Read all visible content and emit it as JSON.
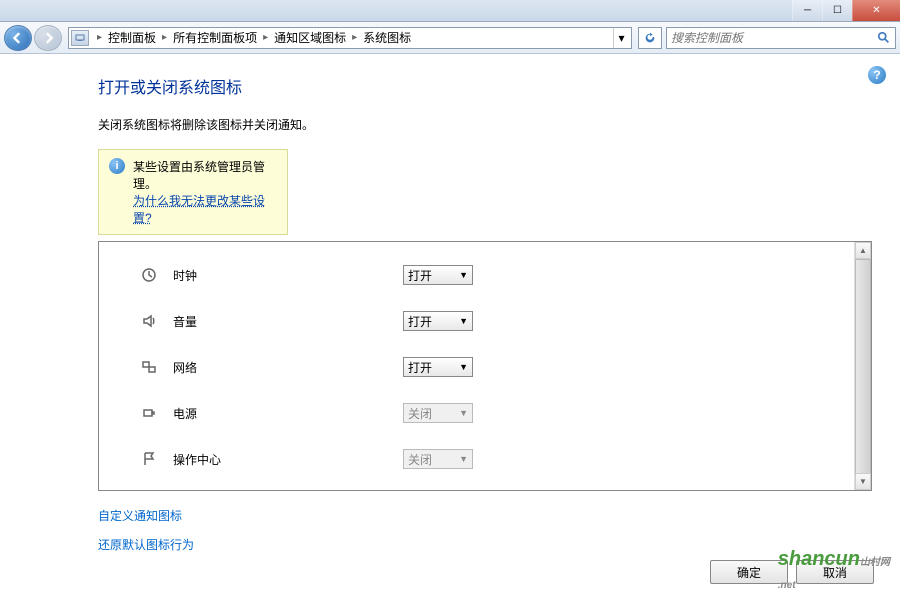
{
  "titlebar": {
    "min": "─",
    "max": "☐",
    "close": "✕"
  },
  "nav": {
    "breadcrumbs": [
      "控制面板",
      "所有控制面板项",
      "通知区域图标",
      "系统图标"
    ],
    "search_placeholder": "搜索控制面板"
  },
  "page": {
    "title": "打开或关闭系统图标",
    "desc": "关闭系统图标将删除该图标并关闭通知。",
    "info_line1": "某些设置由系统管理员管理。",
    "info_link": "为什么我无法更改某些设置?",
    "help": "?"
  },
  "rows": [
    {
      "label": "时钟",
      "value": "打开",
      "enabled": true
    },
    {
      "label": "音量",
      "value": "打开",
      "enabled": true
    },
    {
      "label": "网络",
      "value": "打开",
      "enabled": true
    },
    {
      "label": "电源",
      "value": "关闭",
      "enabled": false
    },
    {
      "label": "操作中心",
      "value": "关闭",
      "enabled": false
    }
  ],
  "links": {
    "customize": "自定义通知图标",
    "restore": "还原默认图标行为"
  },
  "buttons": {
    "ok": "确定",
    "cancel": "取消"
  },
  "watermark": "shancun"
}
